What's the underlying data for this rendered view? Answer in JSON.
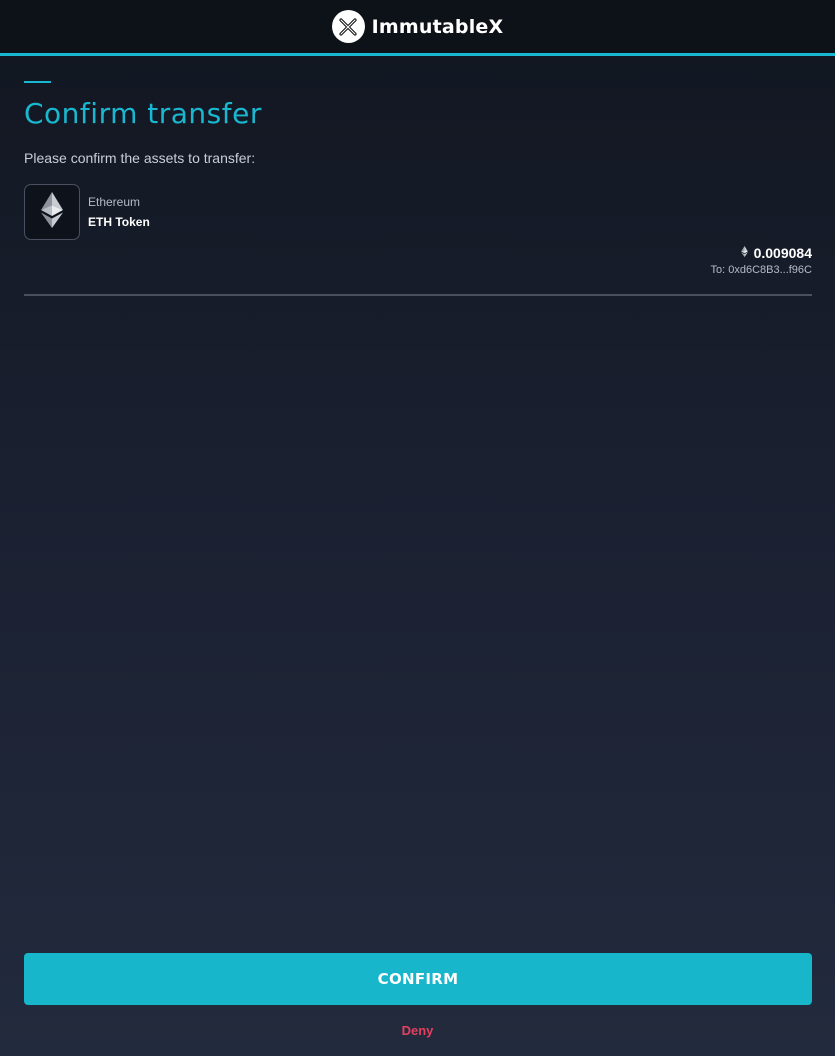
{
  "header": {
    "brand_name": "ImmutableX",
    "logo_icon": "immutable-x-logo-icon"
  },
  "main": {
    "title": "Confirm transfer",
    "subtitle": "Please confirm the assets to transfer:"
  },
  "asset": {
    "icon": "ethereum-icon",
    "network": "Ethereum",
    "name": "ETH Token",
    "amount_icon": "eth-small-icon",
    "amount": "0.009084",
    "recipient": "To: 0xd6C8B3...f96C"
  },
  "actions": {
    "confirm_label": "CONFIRM",
    "deny_label": "Deny"
  },
  "colors": {
    "accent": "#1ab8d0",
    "confirm_bg": "#17b6cb",
    "deny": "#e5405e",
    "header_bg": "#0d1118"
  }
}
